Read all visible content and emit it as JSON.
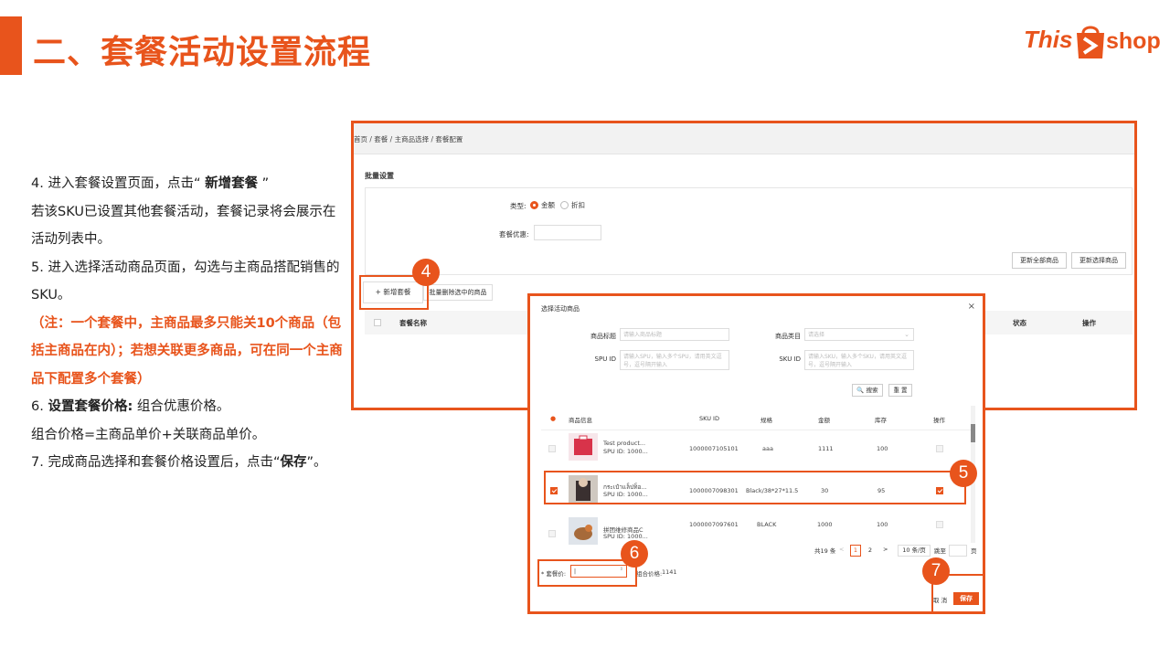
{
  "slide": {
    "title": "二、套餐活动设置流程",
    "logo_part1": "This",
    "logo_part2": "shop"
  },
  "instructions": {
    "s4_prefix": "4. 进入套餐设置页面，点击“ ",
    "s4_bold": "新增套餐",
    "s4_suffix": " ”",
    "s4_detail": "若该SKU已设置其他套餐活动，套餐记录将会展示在活动列表中。",
    "s5": "5. 进入选择活动商品页面，勾选与主商品搭配销售的SKU。",
    "note": "（注：一个套餐中，主商品最多只能关10个商品（包括主商品在内）；若想关联更多商品，可在同一个主商品下配置多个套餐）",
    "s6_prefix": "6. ",
    "s6_bold": "设置套餐价格:",
    "s6_suffix": " 组合优惠价格。",
    "s6_formula": "组合价格=主商品单价+关联商品单价。",
    "s7_prefix": "7. 完成商品选择和套餐价格设置后，点击“",
    "s7_bold": "保存",
    "s7_suffix": "”。"
  },
  "steps": [
    "4",
    "5",
    "6",
    "7"
  ],
  "bg_page": {
    "breadcrumb": "首页 / 套餐 / 主商品选择 / 套餐配置",
    "bulk_title": "批量设置",
    "type_label": "类型:",
    "type_options": [
      "金额",
      "折扣"
    ],
    "discount_label": "套餐优惠:",
    "update_all": "更新全部商品",
    "update_selected": "更新选择商品",
    "add_package": "+ 新增套餐",
    "bulk_delete": "批量删除选中的商品",
    "col_name": "套餐名称",
    "col_status": "状态",
    "col_action": "操作"
  },
  "modal": {
    "title": "选择活动商品",
    "close": "×",
    "f_title_label": "商品标题",
    "f_title_ph": "请输入商品标题",
    "f_cat_label": "商品类目",
    "f_cat_ph": "请选择",
    "f_spu_label": "SPU ID",
    "f_spu_ph": "请输入SPU，输入多个SPU，请用英文逗号，逗号隔开输入",
    "f_sku_label": "SKU ID",
    "f_sku_ph": "请输入SKU，输入多个SKU，请用英文逗号，逗号隔开输入",
    "search_btn": "🔍 搜索",
    "reset_btn": "重 置",
    "cols": [
      "商品信息",
      "SKU ID",
      "规格",
      "金额",
      "库存",
      "操作"
    ],
    "rows": [
      {
        "name": "Test product...",
        "spu": "SPU ID: 1000...",
        "sku": "1000007105101",
        "spec": "aaa",
        "amount": "1111",
        "stock": "100"
      },
      {
        "name": "กระเป๋าแล็ปท็อ...",
        "spu": "SPU ID: 1000...",
        "sku": "1000007098301",
        "spec": "Black/38*27*11.5",
        "amount": "30",
        "stock": "95"
      },
      {
        "name": "拼团维修商品C",
        "spu": "SPU ID: 1000...",
        "sku": "1000007097601",
        "spec": "BLACK",
        "amount": "1000",
        "stock": "100"
      }
    ],
    "total": "共19 条",
    "pages": [
      "1",
      "2"
    ],
    "per_page": "10 条/页",
    "goto": "跳至",
    "page_unit": "页",
    "price_label": "* 套餐价:",
    "combo_label": "组合价格:",
    "combo_value": "1141",
    "cancel": "取 消",
    "save": "保存"
  }
}
